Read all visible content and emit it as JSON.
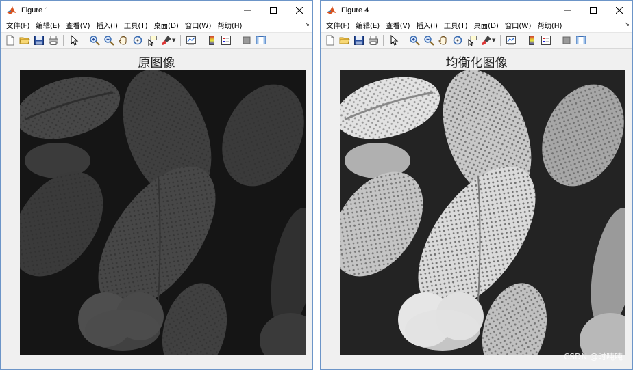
{
  "windows": [
    {
      "title": "Figure 1",
      "axes_title": "原图像",
      "menus": [
        "文件(F)",
        "编辑(E)",
        "查看(V)",
        "插入(I)",
        "工具(T)",
        "桌面(D)",
        "窗口(W)",
        "帮助(H)"
      ]
    },
    {
      "title": "Figure 4",
      "axes_title": "均衡化图像",
      "menus": [
        "文件(F)",
        "编辑(E)",
        "查看(V)",
        "插入(I)",
        "工具(T)",
        "桌面(D)",
        "窗口(W)",
        "帮助(H)"
      ]
    }
  ],
  "watermark": "CSDN @时吨吨",
  "icons": {
    "app": "matlab-icon",
    "minimize": "minimize-icon",
    "maximize": "maximize-icon",
    "close": "close-icon",
    "toolbar": [
      "new-figure-icon",
      "open-file-icon",
      "save-icon",
      "print-icon",
      "edit-plot-icon",
      "zoom-in-icon",
      "zoom-out-icon",
      "pan-icon",
      "rotate-icon",
      "data-cursor-icon",
      "brush-icon",
      "link-plot-icon",
      "colorbar-icon",
      "legend-icon",
      "hide-plot-tools-icon",
      "show-plot-tools-icon"
    ]
  },
  "colors": {
    "window_border": "#6c95c8",
    "client_bg": "#f0f0f0"
  }
}
